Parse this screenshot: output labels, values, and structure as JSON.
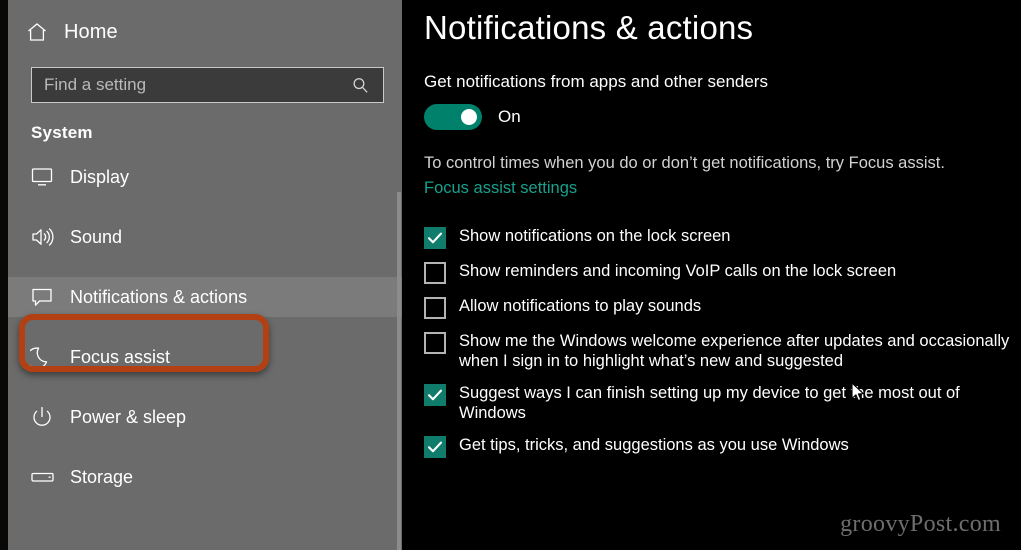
{
  "sidebar": {
    "home": {
      "label": "Home",
      "icon": "home-icon"
    },
    "search": {
      "value": "",
      "placeholder": "Find a setting",
      "icon": "search-icon"
    },
    "group_title": "System",
    "items": [
      {
        "label": "Display",
        "icon": "monitor-icon",
        "selected": false
      },
      {
        "label": "Sound",
        "icon": "speaker-icon",
        "selected": false
      },
      {
        "label": "Notifications & actions",
        "icon": "speech-bubble-icon",
        "selected": true
      },
      {
        "label": "Focus assist",
        "icon": "moon-icon",
        "selected": false
      },
      {
        "label": "Power & sleep",
        "icon": "power-icon",
        "selected": false
      },
      {
        "label": "Storage",
        "icon": "drive-icon",
        "selected": false
      }
    ]
  },
  "main": {
    "title": "Notifications & actions",
    "section_label": "Get notifications from apps and other senders",
    "toggle": {
      "state": "On",
      "checked": true,
      "color": "#00816c"
    },
    "hint_text": "To control times when you do or don’t get notifications, try Focus assist.",
    "link_label": "Focus assist settings",
    "link_color": "#18a08c",
    "checkboxes": [
      {
        "label": "Show notifications on the lock screen",
        "checked": true
      },
      {
        "label": "Show reminders and incoming VoIP calls on the lock screen",
        "checked": false
      },
      {
        "label": "Allow notifications to play sounds",
        "checked": false
      },
      {
        "label": "Show me the Windows welcome experience after updates and occasionally when I sign in to highlight what’s new and suggested",
        "checked": false
      },
      {
        "label": "Suggest ways I can finish setting up my device to get the most out of Windows",
        "checked": true
      },
      {
        "label": "Get tips, tricks, and suggestions as you use Windows",
        "checked": true
      }
    ]
  },
  "annotation": {
    "color": "#b34012",
    "target": "Notifications & actions"
  },
  "watermark": "groovyPost.com"
}
